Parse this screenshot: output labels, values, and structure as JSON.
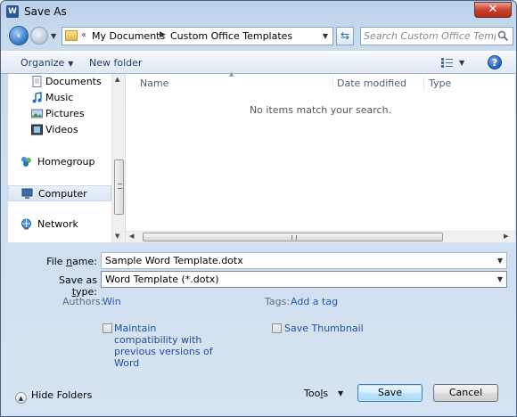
{
  "window": {
    "title": "Save As",
    "app_icon": "W",
    "close_symbol": "✕"
  },
  "address": {
    "overflow_chevron": "«",
    "segments": [
      "My Documents",
      "Custom Office Templates"
    ]
  },
  "search": {
    "placeholder": "Search Custom Office Templates"
  },
  "toolbar": {
    "organize_label": "Organize",
    "new_folder_label": "New folder",
    "help_symbol": "?"
  },
  "navigation": {
    "items": [
      {
        "label": "Documents",
        "icon": "documents-icon",
        "level": "child"
      },
      {
        "label": "Music",
        "icon": "music-icon",
        "level": "child"
      },
      {
        "label": "Pictures",
        "icon": "pictures-icon",
        "level": "child"
      },
      {
        "label": "Videos",
        "icon": "videos-icon",
        "level": "child"
      },
      {
        "label": "Homegroup",
        "icon": "homegroup-icon",
        "level": "top"
      },
      {
        "label": "Computer",
        "icon": "computer-icon",
        "level": "top",
        "selected": true
      },
      {
        "label": "Network",
        "icon": "network-icon",
        "level": "top"
      }
    ]
  },
  "file_list": {
    "columns": [
      "Name",
      "Date modified",
      "Type"
    ],
    "empty_message": "No items match your search."
  },
  "form": {
    "file_name_label_pre": "File ",
    "file_name_label_key": "n",
    "file_name_label_post": "ame:",
    "file_name_value": "Sample Word Template.dotx",
    "save_type_label_pre": "Save as ",
    "save_type_label_key": "t",
    "save_type_label_post": "ype:",
    "save_type_value": "Word Template (*.dotx)",
    "authors_label": "Authors:",
    "authors_value": "Win",
    "tags_label": "Tags:",
    "tags_value": "Add a tag",
    "maintain_compat_lines": [
      "Maintain",
      "compatibility with",
      "previous versions of",
      "Word"
    ],
    "save_thumbnail_label": "Save Thumbnail"
  },
  "footer": {
    "hide_folders_label": "Hide Folders",
    "tools_label_pre": "Too",
    "tools_label_key": "l",
    "tools_label_post": "s",
    "save_label": "Save",
    "cancel_label": "Cancel"
  },
  "colors": {
    "accent": "#2a5aa8",
    "titlebar": "#b9d1ea",
    "close": "#c9432d"
  }
}
